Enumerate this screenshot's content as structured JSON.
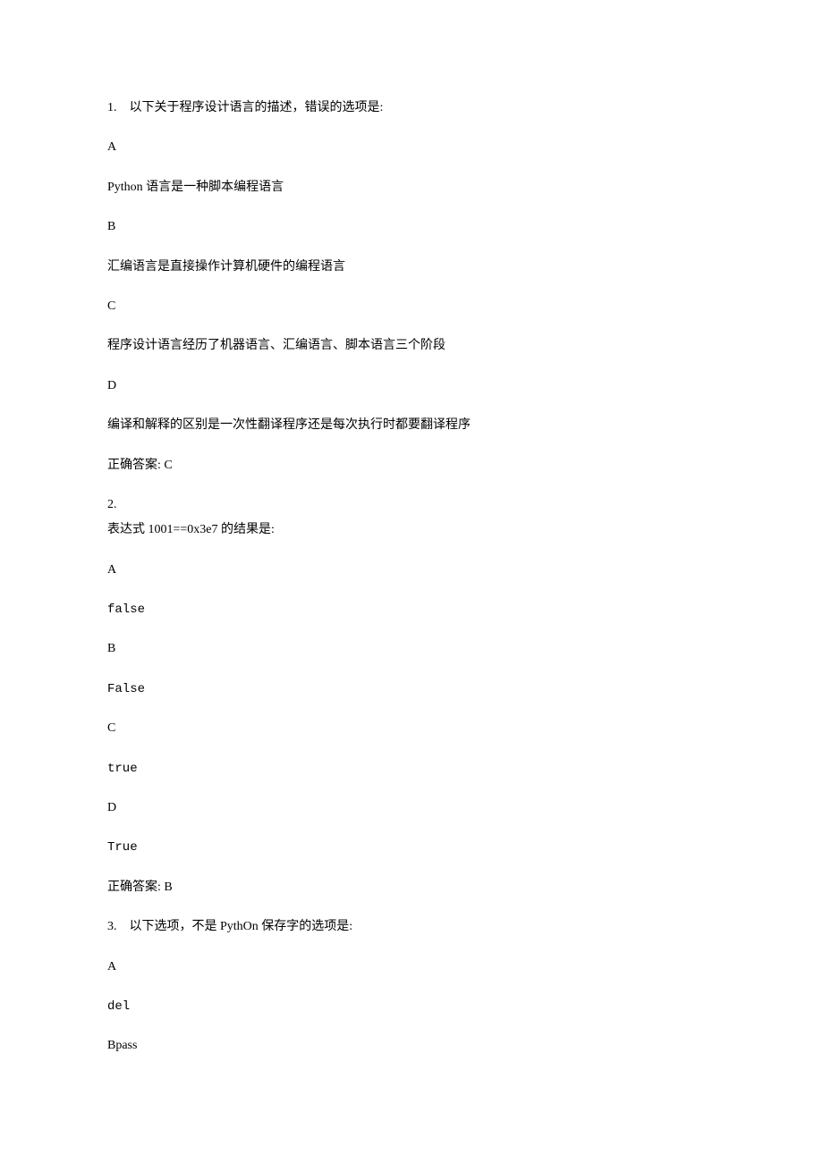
{
  "q1": {
    "num": "1. ",
    "stem": "以下关于程序设计语言的描述，错误的选项是:",
    "A_label": "A",
    "A_text": "Python 语言是一种脚本编程语言",
    "B_label": "B",
    "B_text": "汇编语言是直接操作计算机硬件的编程语言",
    "C_label": "C",
    "C_text": "程序设计语言经历了机器语言、汇编语言、脚本语言三个阶段",
    "D_label": "D",
    "D_text": "编译和解释的区别是一次性翻译程序还是每次执行时都要翻译程序",
    "answer": "正确答案: C"
  },
  "q2": {
    "num": "2.",
    "stem": "表达式 1001==0x3e7 的结果是:",
    "A_label": "A",
    "A_text": "false",
    "B_label": "B",
    "B_text": "False",
    "C_label": "C",
    "C_text": "true",
    "D_label": "D",
    "D_text": "True",
    "answer": "正确答案: B"
  },
  "q3": {
    "num": "3. ",
    "stem": "以下选项，不是 PythOn 保存字的选项是:",
    "A_label": "A",
    "A_text": "del",
    "B_label": "Bpass"
  }
}
